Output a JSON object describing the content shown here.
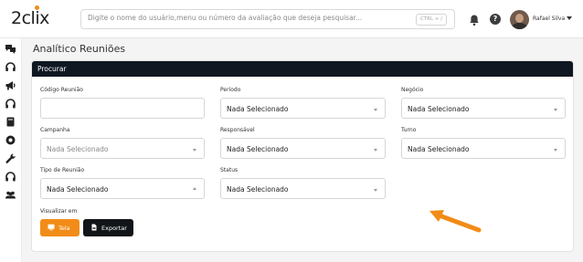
{
  "header": {
    "logo_text": "2clix",
    "search_placeholder": "Digite o nome do usuário,menu ou número da avaliação que deseja pesquisar...",
    "search_shortcut": "CTRL + /",
    "user_name": "Rafael Silva",
    "help_glyph": "?",
    "icons": [
      "bell-icon",
      "help-icon",
      "user-avatar",
      "chevron-down-icon"
    ]
  },
  "sidebar": {
    "items": [
      {
        "icon": "chat-bubbles-icon"
      },
      {
        "icon": "headset-icon"
      },
      {
        "icon": "megaphone-icon"
      },
      {
        "icon": "headphones-icon"
      },
      {
        "icon": "book-icon"
      },
      {
        "icon": "badge-icon"
      },
      {
        "icon": "wrench-icon"
      },
      {
        "icon": "headset-icon"
      },
      {
        "icon": "users-icon"
      }
    ]
  },
  "page": {
    "title": "Analítico Reuniões"
  },
  "panel": {
    "header": "Procurar",
    "fields": {
      "codigo_reuniao": {
        "label": "Código Reunião",
        "value": ""
      },
      "periodo": {
        "label": "Período",
        "value": "Nada Selecionado"
      },
      "negocio": {
        "label": "Negócio",
        "value": "Nada Selecionado"
      },
      "campanha": {
        "label": "Campanha",
        "value": "Nada Selecionado"
      },
      "responsavel": {
        "label": "Responsável",
        "value": "Nada Selecionado"
      },
      "turno": {
        "label": "Turno",
        "value": "Nada Selecionado"
      },
      "tipo_reuniao": {
        "label": "Tipo de Reunião",
        "value": "Nada Selecionado"
      },
      "status": {
        "label": "Status",
        "value": "Nada Selecionado"
      }
    },
    "visualizar_label": "Visualizar em",
    "buttons": {
      "tela": "Tela",
      "exportar": "Exportar"
    }
  },
  "colors": {
    "accent_orange": "#f28c18",
    "panel_header": "#0f1722",
    "dark_button": "#111418"
  }
}
